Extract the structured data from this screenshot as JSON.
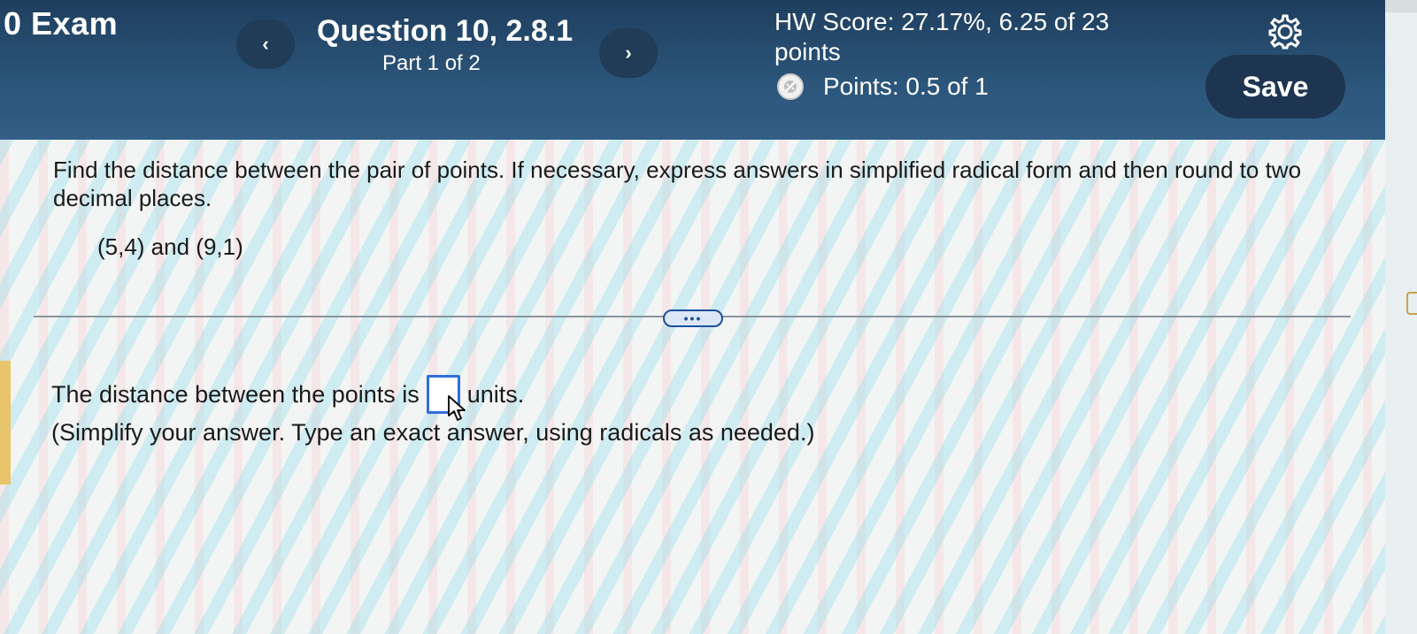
{
  "header": {
    "exam_title": "0 Exam",
    "prev_label": "‹",
    "next_label": "›",
    "question_title": "Question 10, 2.8.1",
    "part_label": "Part 1 of 2",
    "hw_score": "HW Score: 27.17%, 6.25 of 23 points",
    "points_icon": "partial-credit-icon",
    "points_label": "Points: 0.5 of 1",
    "settings_icon": "gear-icon",
    "save_label": "Save"
  },
  "question": {
    "instructions": "Find the distance between the pair of points. If necessary, express answers in simplified radical form and then round to two decimal places.",
    "points_given": "(5,4) and (9,1)",
    "more_label": "•••"
  },
  "answer": {
    "prefix": "The distance between the points is",
    "input_value": "",
    "suffix": "units.",
    "hint": "(Simplify your answer. Type an exact answer, using radicals as needed.)"
  },
  "colors": {
    "header_bg": "#2b557a",
    "button_bg": "#1d3550",
    "input_border": "#2f6fd8",
    "accent": "#e8c46b"
  }
}
